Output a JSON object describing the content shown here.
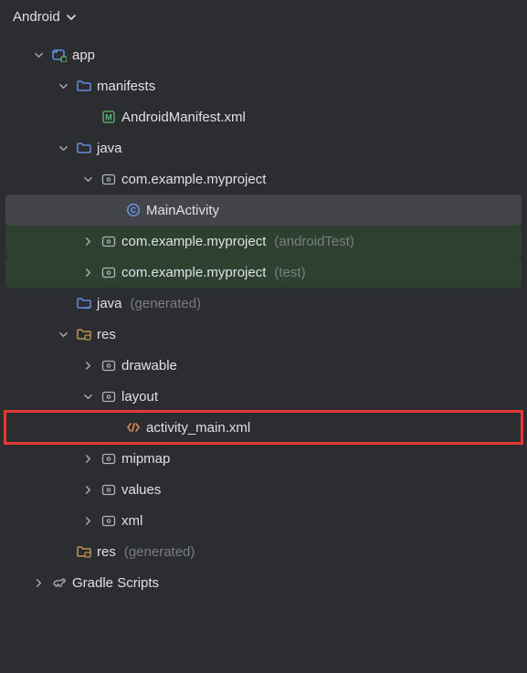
{
  "header": {
    "viewLabel": "Android"
  },
  "tree": {
    "app": "app",
    "manifests": "manifests",
    "androidManifest": "AndroidManifest.xml",
    "java": "java",
    "pkg": "com.example.myproject",
    "mainActivity": "MainActivity",
    "pkgAndroidTest": "com.example.myproject",
    "pkgAndroidTestSuffix": "(androidTest)",
    "pkgTest": "com.example.myproject",
    "pkgTestSuffix": "(test)",
    "javaGen": "java",
    "javaGenSuffix": "(generated)",
    "res": "res",
    "drawable": "drawable",
    "layout": "layout",
    "activityMain": "activity_main.xml",
    "mipmap": "mipmap",
    "values": "values",
    "xml": "xml",
    "resGen": "res",
    "resGenSuffix": "(generated)",
    "gradleScripts": "Gradle Scripts"
  }
}
